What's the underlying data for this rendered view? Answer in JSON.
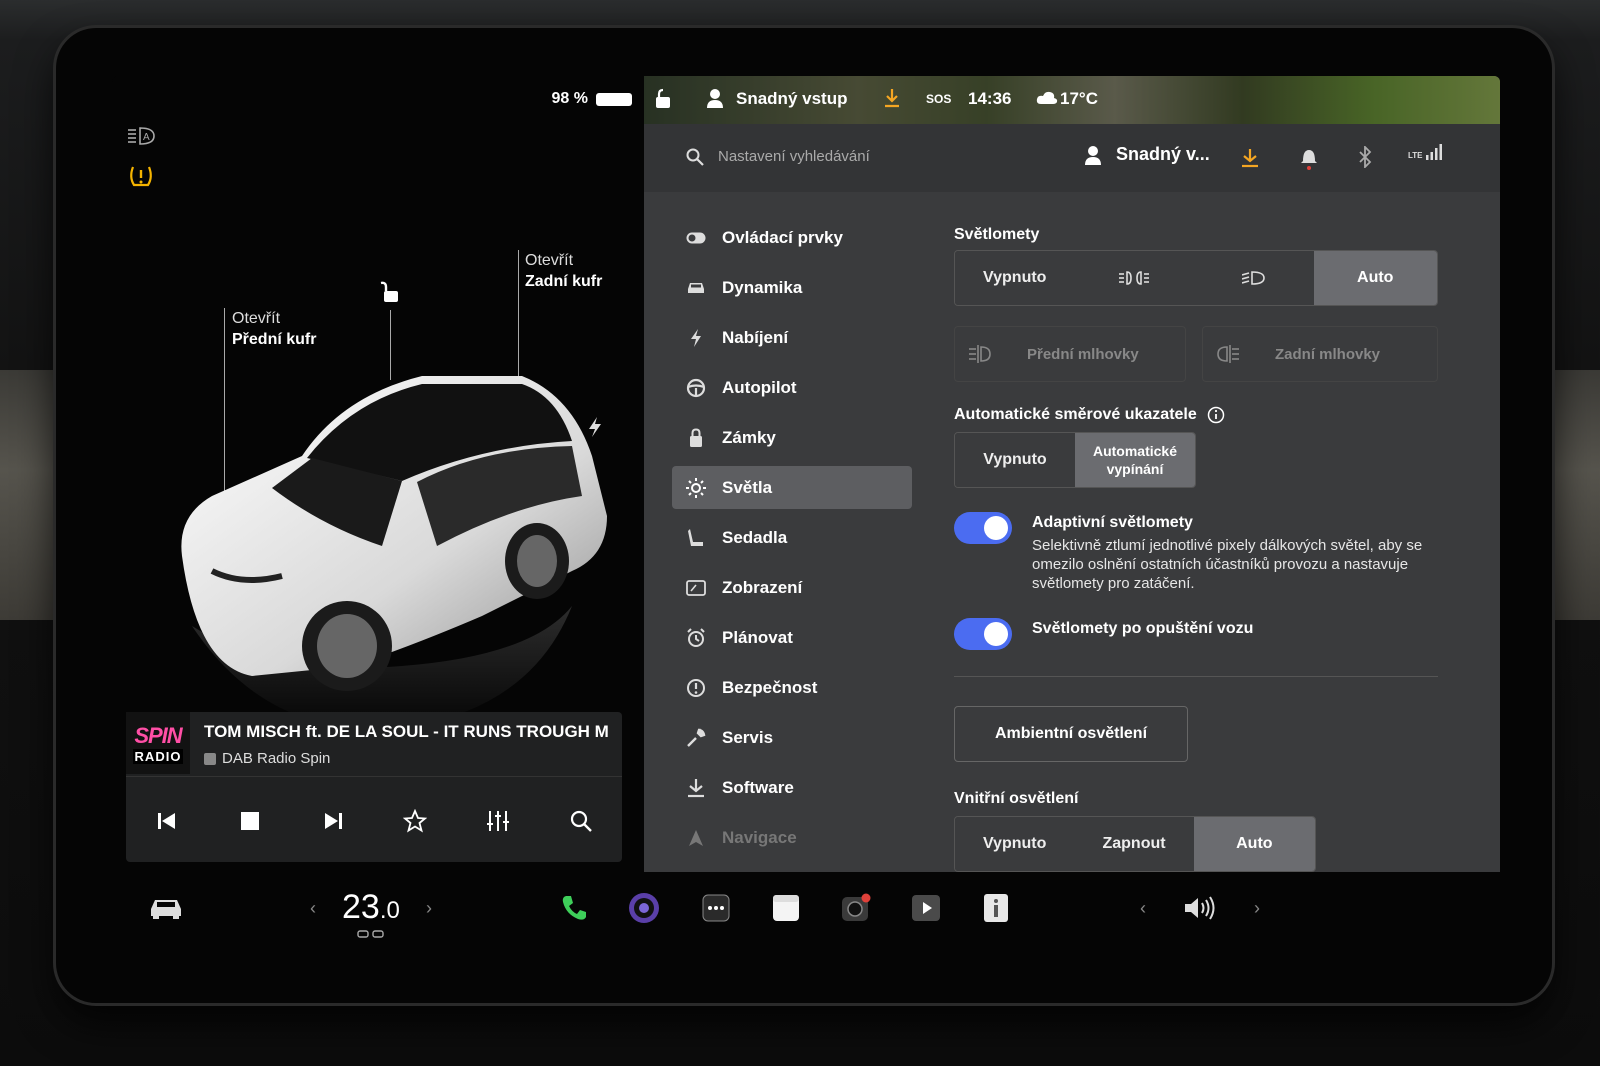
{
  "left": {
    "battery": "98 %",
    "callouts": {
      "front": {
        "action": "Otevřít",
        "target": "Přední kufr"
      },
      "rear": {
        "action": "Otevřít",
        "target": "Zadní kufr"
      }
    }
  },
  "media": {
    "logo_top": "SPIN",
    "logo_bottom": "RADIO",
    "track": "TOM MISCH ft. DE LA SOUL - IT RUNS TROUGH M",
    "station": "DAB Radio Spin"
  },
  "status_bar": {
    "profile": "Snadný vstup",
    "sos": "SOS",
    "time": "14:36",
    "temperature": "17°C"
  },
  "search": {
    "placeholder": "Nastavení vyhledávání",
    "profile_name": "Snadný v...",
    "lte": "LTE"
  },
  "menu": [
    {
      "label": "Ovládací prvky",
      "icon": "toggle-icon"
    },
    {
      "label": "Dynamika",
      "icon": "car-icon"
    },
    {
      "label": "Nabíjení",
      "icon": "bolt-icon"
    },
    {
      "label": "Autopilot",
      "icon": "steering-wheel-icon"
    },
    {
      "label": "Zámky",
      "icon": "lock-icon"
    },
    {
      "label": "Světla",
      "icon": "sun-icon"
    },
    {
      "label": "Sedadla",
      "icon": "seat-icon"
    },
    {
      "label": "Zobrazení",
      "icon": "display-icon"
    },
    {
      "label": "Plánovat",
      "icon": "alarm-icon"
    },
    {
      "label": "Bezpečnost",
      "icon": "alert-icon"
    },
    {
      "label": "Servis",
      "icon": "wrench-icon"
    },
    {
      "label": "Software",
      "icon": "download-icon"
    },
    {
      "label": "Navigace",
      "icon": "navigation-icon"
    }
  ],
  "lights": {
    "headlights_title": "Světlomety",
    "headlights_options": {
      "off": "Vypnuto",
      "auto": "Auto"
    },
    "headlights_selected": "Auto",
    "front_fog": "Přední mlhovky",
    "rear_fog": "Zadní mlhovky",
    "turn_title": "Automatické směrové ukazatele",
    "turn_options": {
      "off": "Vypnuto",
      "auto": "Automatické vypínání"
    },
    "turn_selected": "Automatické vypínání",
    "adaptive_label": "Adaptivní světlomety",
    "adaptive_desc": "Selektivně ztlumí jednotlivé pixely dálkových světel, aby se omezilo oslnění ostatních účastníků provozu a nastavuje světlomety pro zatáčení.",
    "adaptive_on": true,
    "exit_label": "Světlomety po opuštění vozu",
    "exit_on": true,
    "ambient_button": "Ambientní osvětlení",
    "interior_title": "Vnitřní osvětlení",
    "interior_options": {
      "off": "Vypnuto",
      "on": "Zapnout",
      "auto": "Auto"
    },
    "interior_selected": "Auto"
  },
  "dock": {
    "temp_int": "23",
    "temp_dec": ".0"
  },
  "colors": {
    "accent": "#4b6cf1",
    "warning": "#f5b400",
    "download": "#f5a623"
  }
}
